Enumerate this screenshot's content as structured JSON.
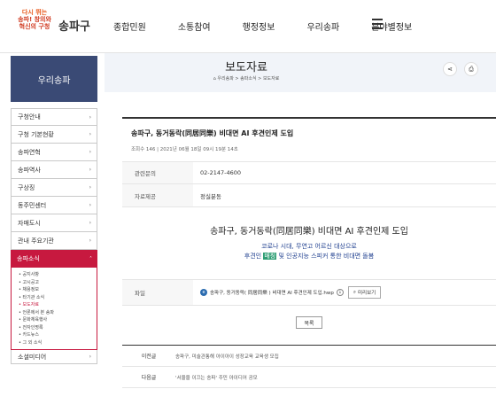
{
  "header": {
    "slogan_line1": "다시 뛰는",
    "slogan_line2": "송파! 창의와",
    "slogan_line3": "혁신의 구청",
    "site_name": "송파구",
    "gnb": [
      "종합민원",
      "소통참여",
      "행정정보",
      "우리송파",
      "분야별정보"
    ]
  },
  "sidebar": {
    "title": "우리송파",
    "items": [
      "구청안내",
      "구청 기본현황",
      "송파연혁",
      "송파역사",
      "구상징",
      "동주민센터",
      "자매도시",
      "관내 주요기관"
    ],
    "active": "송파소식",
    "sub_items": [
      "공지사항",
      "고시공고",
      "채용정보",
      "타기관 소식",
      "보도자료",
      "언론에서 본 송파",
      "문화체육행사",
      "전자인명록",
      "카드뉴스",
      "그 외 소식"
    ],
    "active_sub": "보도자료",
    "bottom": "소셜미디어"
  },
  "banner": {
    "title": "보도자료",
    "crumbs": "⌂ 우리송파 > 송파소식 > 보도자료"
  },
  "article": {
    "title": "송파구, 동거동락(同居同樂) 비대면 AI 후견인제 도입",
    "meta": "조회수 146  |  2021년 06월 18일 09시 19분 14초",
    "info": [
      {
        "label": "관련문의",
        "value": "02-2147-4600"
      },
      {
        "label": "자료제공",
        "value": "정실분동"
      }
    ],
    "body_head": "송파구, 동거동락(同居同樂) 비대면 AI 후견인제 도입",
    "body_sub1": "코로나 시대, 무연고 어르신 대상으로",
    "body_sub2a": "후견인 ",
    "body_sub2b": "매칭",
    "body_sub2c": " 및 인공지능 스피커 통한 비대면 돌봄",
    "file_label": "파일",
    "file_name": "송파구, 동거동락( 同居同樂 ) 비대면 AI 후견인제 도입.hwp",
    "preview": "미리보기",
    "list_btn": "목록",
    "prev_label": "이전글",
    "prev_text": "송파구, 미술관통해 아이아이 성장교육 교육생 모집",
    "next_label": "다음글",
    "next_text": "'서울을 이끄는 송파' 주민 아이디어 공모"
  }
}
